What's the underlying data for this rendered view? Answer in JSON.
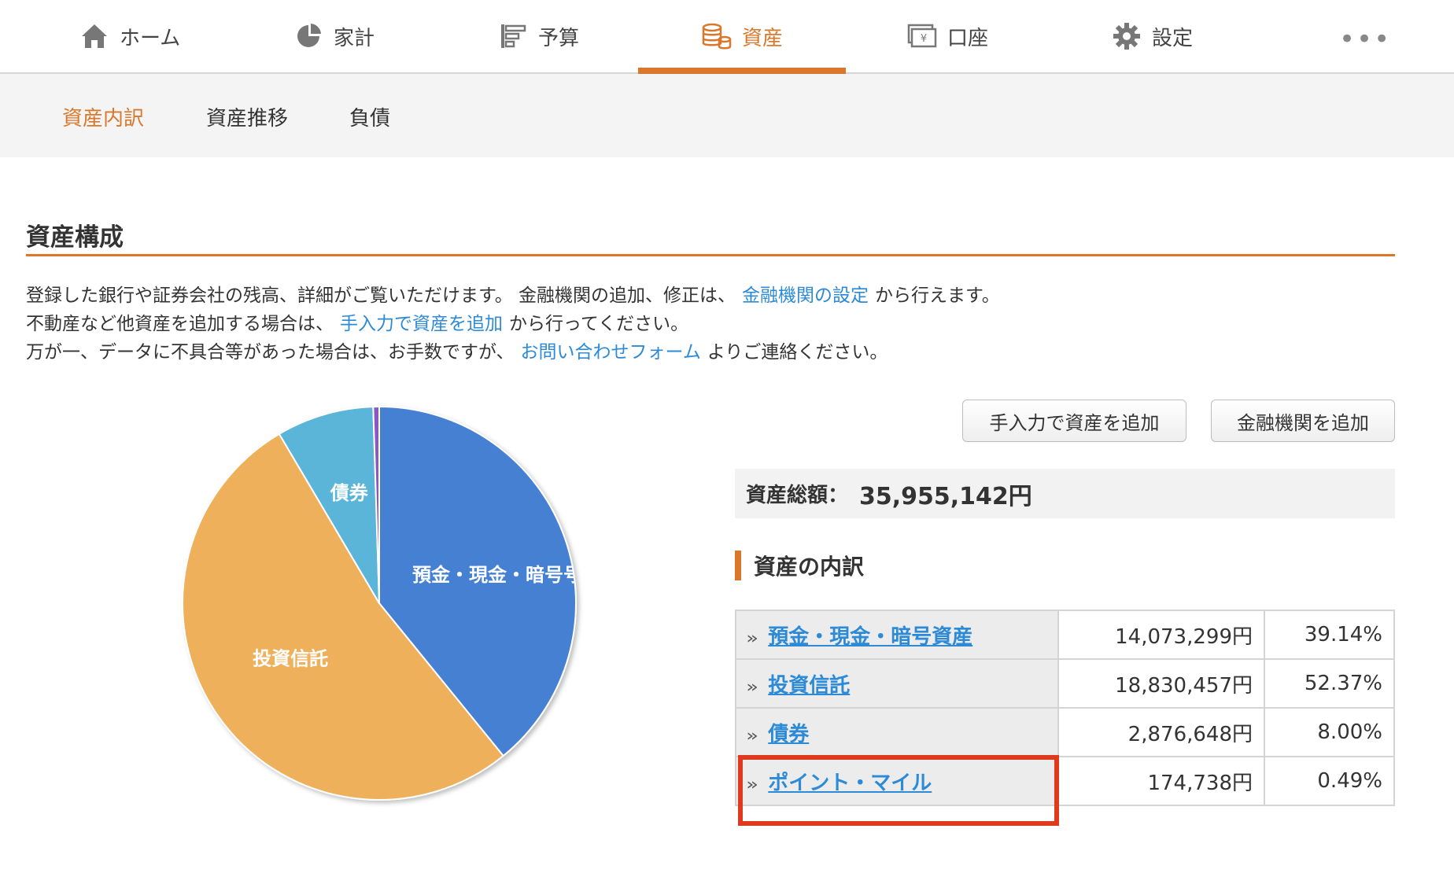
{
  "nav": {
    "items": [
      {
        "label": "ホーム",
        "icon": "home-icon"
      },
      {
        "label": "家計",
        "icon": "pie-chart-icon"
      },
      {
        "label": "予算",
        "icon": "budget-bars-icon"
      },
      {
        "label": "資産",
        "icon": "coins-icon"
      },
      {
        "label": "口座",
        "icon": "account-icon"
      },
      {
        "label": "設定",
        "icon": "gear-icon"
      }
    ],
    "active": "資産",
    "more_label": "•••"
  },
  "subnav": {
    "items": [
      "資産内訳",
      "資産推移",
      "負債"
    ],
    "active": "資産内訳"
  },
  "section": {
    "title": "資産構成",
    "line1_text": "登録した銀行や証券会社の残高、詳細がご覧いただけます。 金融機関の追加、修正は、",
    "line1_link": "金融機関の設定",
    "line1_tail": "から行えます。",
    "line2_text": "不動産など他資産を追加する場合は、",
    "line2_link": "手入力で資産を追加",
    "line2_tail": "から行ってください。",
    "line3_text": "万が一、データに不具合等があった場合は、お手数ですが、",
    "line3_link": "お問い合わせフォーム",
    "line3_tail": "よりご連絡ください。"
  },
  "buttons": {
    "manual_add": "手入力で資産を追加",
    "institution_add": "金融機関を追加"
  },
  "total": {
    "label": "資産総額：",
    "value": "35,955,142円"
  },
  "breakdown": {
    "title": "資産の内訳",
    "rows": [
      {
        "category": "預金・現金・暗号資産",
        "amount": "14,073,299円",
        "percent": "39.14%"
      },
      {
        "category": "投資信託",
        "amount": "18,830,457円",
        "percent": "52.37%"
      },
      {
        "category": "債券",
        "amount": "2,876,648円",
        "percent": "8.00%"
      },
      {
        "category": "ポイント・マイル",
        "amount": "174,738円",
        "percent": "0.49%"
      }
    ]
  },
  "chart_data": {
    "type": "pie",
    "categories": [
      "預金・現金・暗号資産",
      "投資信託",
      "債券",
      "ポイント・マイル"
    ],
    "values": [
      39.14,
      52.37,
      8.0,
      0.49
    ],
    "labels_shown": [
      "預金・現金・暗号号",
      "投資信託",
      "債券",
      ""
    ],
    "colors": [
      "#4580d3",
      "#efb05c",
      "#5ab5d8",
      "#8a56c8"
    ]
  },
  "colors": {
    "accent": "#d9772b",
    "link": "#2c8ad6",
    "highlight": "#e03a1e"
  }
}
